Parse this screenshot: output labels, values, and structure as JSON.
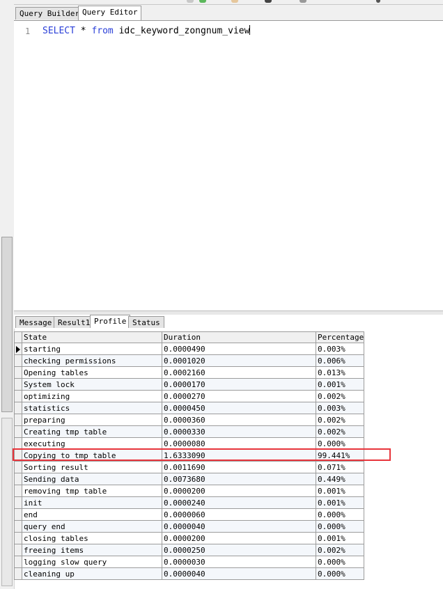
{
  "editor_tabs": [
    {
      "label": "Query Builder",
      "active": false
    },
    {
      "label": "Query Editor",
      "active": true
    }
  ],
  "editor": {
    "line_number": "1",
    "sql": {
      "kw1": "SELECT",
      "star": " * ",
      "kw2": "from",
      "table": " idc_keyword_zongnum_view"
    }
  },
  "result_tabs": [
    {
      "label": "Message",
      "active": false
    },
    {
      "label": "Result1",
      "active": false
    },
    {
      "label": "Profile",
      "active": true
    },
    {
      "label": "Status",
      "active": false
    }
  ],
  "grid": {
    "columns": [
      "State",
      "Duration",
      "Percentage"
    ],
    "rows": [
      {
        "state": "starting",
        "duration": "0.0000490",
        "percentage": "0.003%"
      },
      {
        "state": "checking permissions",
        "duration": "0.0001020",
        "percentage": "0.006%"
      },
      {
        "state": "Opening tables",
        "duration": "0.0002160",
        "percentage": "0.013%"
      },
      {
        "state": "System lock",
        "duration": "0.0000170",
        "percentage": "0.001%"
      },
      {
        "state": "optimizing",
        "duration": "0.0000270",
        "percentage": "0.002%"
      },
      {
        "state": "statistics",
        "duration": "0.0000450",
        "percentage": "0.003%"
      },
      {
        "state": "preparing",
        "duration": "0.0000360",
        "percentage": "0.002%"
      },
      {
        "state": "Creating tmp table",
        "duration": "0.0000330",
        "percentage": "0.002%"
      },
      {
        "state": "executing",
        "duration": "0.0000080",
        "percentage": "0.000%"
      },
      {
        "state": "Copying to tmp table",
        "duration": "1.6333090",
        "percentage": "99.441%"
      },
      {
        "state": "Sorting result",
        "duration": "0.0011690",
        "percentage": "0.071%"
      },
      {
        "state": "Sending data",
        "duration": "0.0073680",
        "percentage": "0.449%"
      },
      {
        "state": "removing tmp table",
        "duration": "0.0000200",
        "percentage": "0.001%"
      },
      {
        "state": "init",
        "duration": "0.0000240",
        "percentage": "0.001%"
      },
      {
        "state": "end",
        "duration": "0.0000060",
        "percentage": "0.000%"
      },
      {
        "state": "query end",
        "duration": "0.0000040",
        "percentage": "0.000%"
      },
      {
        "state": "closing tables",
        "duration": "0.0000200",
        "percentage": "0.001%"
      },
      {
        "state": "freeing items",
        "duration": "0.0000250",
        "percentage": "0.002%"
      },
      {
        "state": "logging slow query",
        "duration": "0.0000030",
        "percentage": "0.000%"
      },
      {
        "state": "cleaning up",
        "duration": "0.0000040",
        "percentage": "0.000%"
      }
    ]
  },
  "colors": {
    "keyword": "#2a3fd8",
    "highlight_border": "#e8343b"
  }
}
